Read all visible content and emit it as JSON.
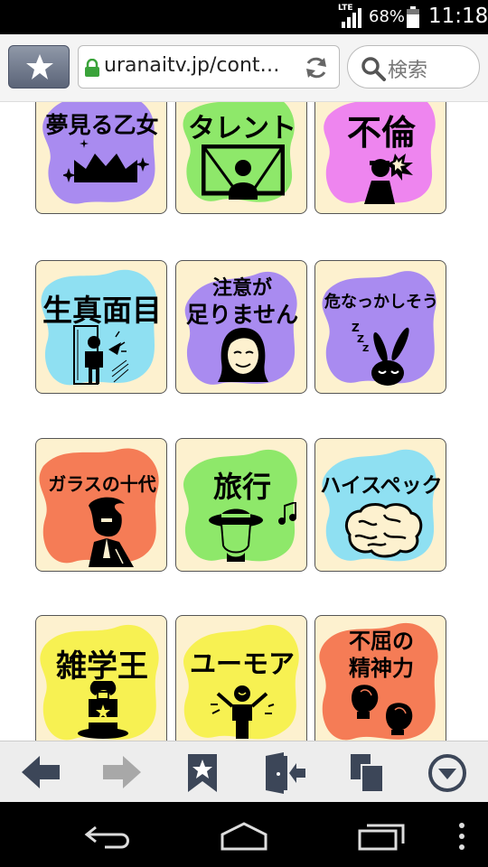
{
  "status_bar": {
    "network": "LTE",
    "battery_percent": "68%",
    "time": "11:18"
  },
  "browser": {
    "url": "uranaitv.jp/cont…",
    "search_placeholder": "検索"
  },
  "grid": {
    "cards": [
      {
        "label": "夢見る乙女",
        "color": "#a98bf0"
      },
      {
        "label": "タレント",
        "color": "#8ee86a"
      },
      {
        "label": "不倫",
        "color": "#ee85ef"
      },
      {
        "label": "生真面目",
        "color": "#8fe0f2"
      },
      {
        "label_line1": "注意が",
        "label_line2": "足りません",
        "color": "#a98bf0"
      },
      {
        "label": "危なっかしそう",
        "color": "#a98bf0"
      },
      {
        "label": "ガラスの十代",
        "color": "#f57c56"
      },
      {
        "label": "旅行",
        "color": "#8ee86a"
      },
      {
        "label": "ハイスペック",
        "color": "#8fe0f2"
      },
      {
        "label": "雑学王",
        "color": "#f7f152"
      },
      {
        "label": "ユーモア",
        "color": "#f7f152"
      },
      {
        "label_line1": "不屈の",
        "label_line2": "精神力",
        "color": "#f57c56"
      }
    ]
  },
  "bottom_bar": {
    "icons": [
      "back-arrow-icon",
      "forward-arrow-icon",
      "bookmark-icon",
      "exit-icon",
      "windows-icon",
      "menu-icon"
    ]
  },
  "nav_bar": {
    "icons": [
      "back-icon",
      "home-icon",
      "recent-apps-icon",
      "overflow-icon"
    ]
  }
}
